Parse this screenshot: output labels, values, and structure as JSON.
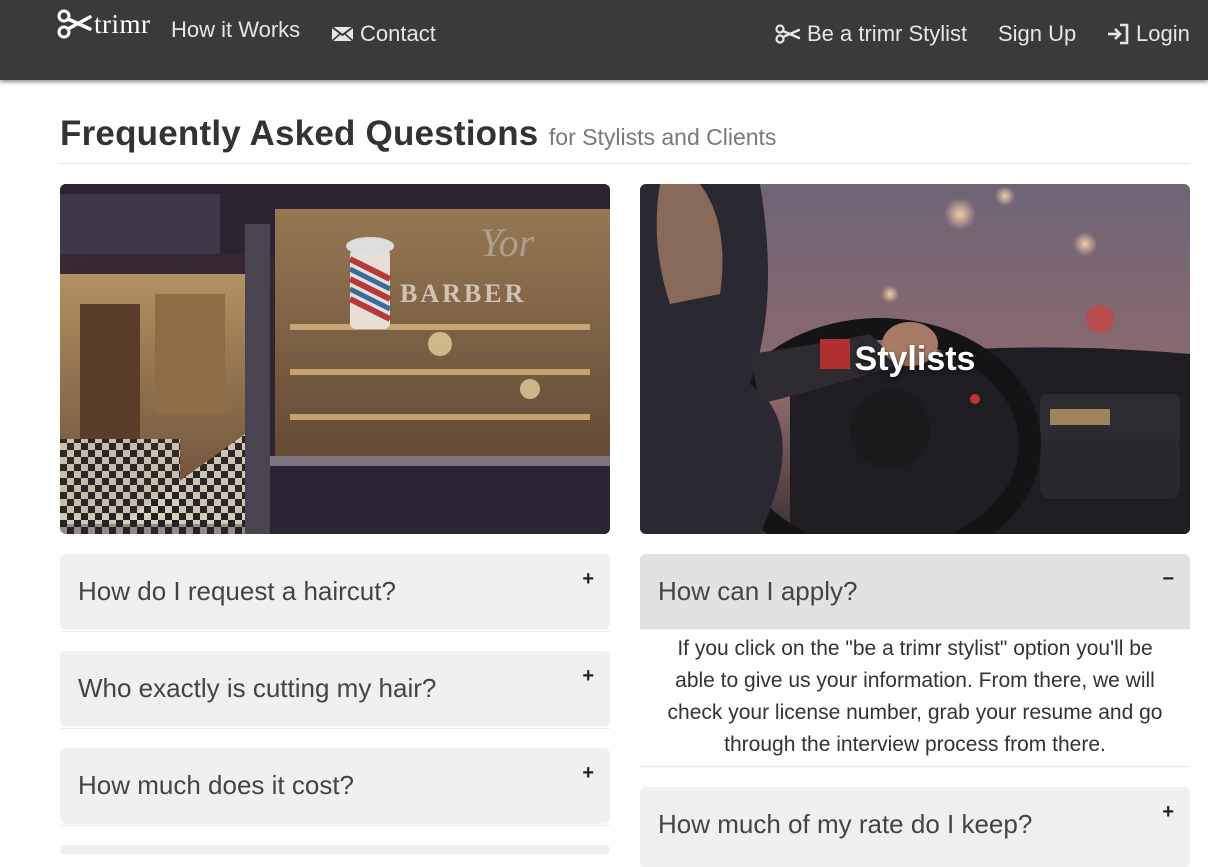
{
  "nav": {
    "brand": "trimr",
    "how_it_works": "How it Works",
    "contact": "Contact",
    "be_stylist": "Be a trimr Stylist",
    "sign_up": "Sign Up",
    "login": "Login"
  },
  "header": {
    "title": "Frequently Asked Questions",
    "subtitle": "for Stylists and Clients"
  },
  "photos": {
    "left_sign": "BARBER",
    "right_caption": "Stylists"
  },
  "clients_faq": [
    {
      "question": "How do I request a haircut?",
      "toggle": "+"
    },
    {
      "question": "Who exactly is cutting my hair?",
      "toggle": "+"
    },
    {
      "question": "How much does it cost?",
      "toggle": "+"
    }
  ],
  "stylists_faq": [
    {
      "question": "How can I apply?",
      "toggle": "−",
      "answer": "If you click on the \"be a trimr stylist\" option you'll be able to give us your information. From there, we will check your license number, grab your resume and go through the interview process from there."
    },
    {
      "question": "How much of my rate do I keep?",
      "toggle": "+"
    }
  ],
  "colors": {
    "navbar": "#3a3a3a",
    "panel": "#f0f0f0",
    "panel_open": "#e2e2e2"
  }
}
